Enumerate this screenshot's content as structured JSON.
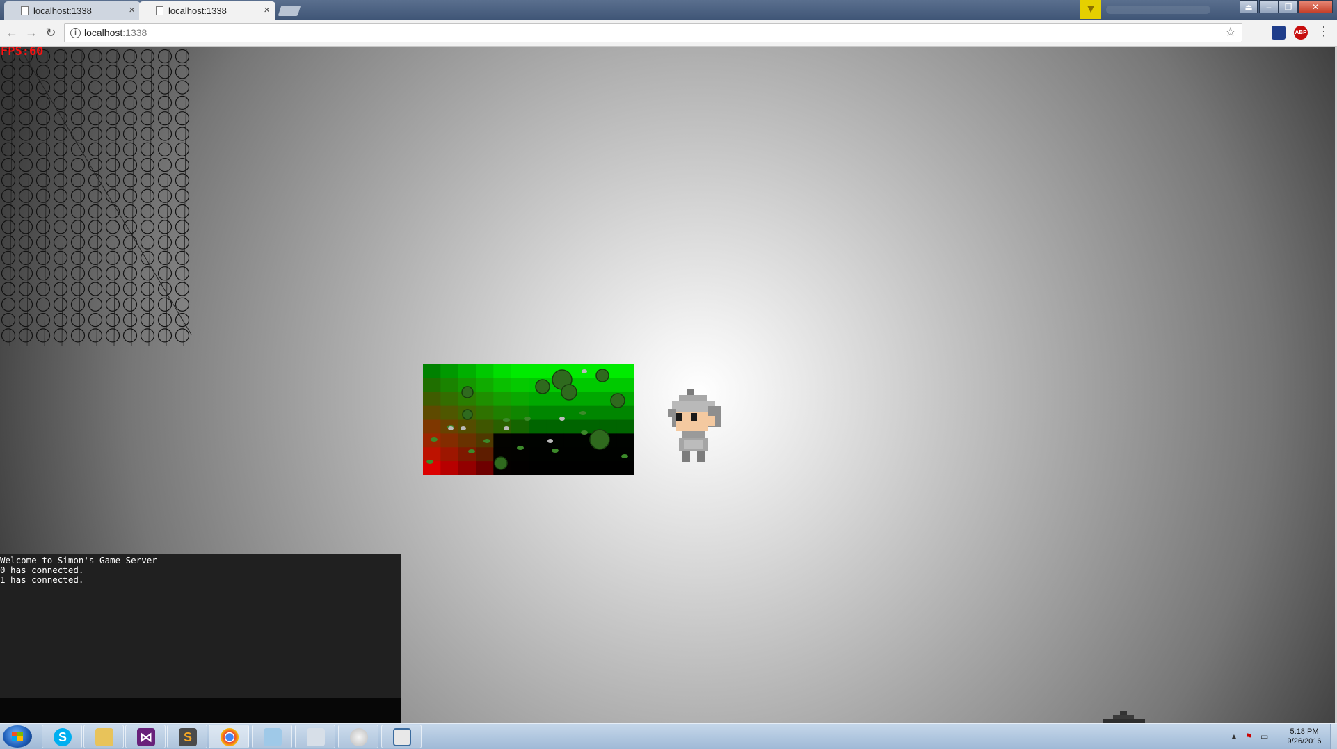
{
  "browser": {
    "tabs": [
      {
        "title": "localhost:1338",
        "active": false
      },
      {
        "title": "localhost:1338",
        "active": true
      }
    ],
    "address": {
      "host": "localhost",
      "port": ":1338"
    },
    "extensions": [
      "bookmark-extension-icon",
      "adblock-plus-icon"
    ],
    "ext_abp_label": "ABP"
  },
  "game": {
    "fps_label": "FPS:60",
    "console": {
      "lines": [
        "Welcome to Simon's Game Server",
        "0 has connected.",
        "1 has connected."
      ]
    },
    "tilemap": {
      "cols": 12,
      "rows": 8
    },
    "grid_overlay": {
      "cols": 11,
      "rows": 19
    }
  },
  "taskbar": {
    "apps": [
      "Skype",
      "Windows Explorer",
      "Visual Studio",
      "Sublime Text",
      "Google Chrome",
      "Sticky Notes",
      "Calculator",
      "Paint",
      "App"
    ],
    "skype_glyph": "S",
    "sublime_glyph": "S",
    "clock": {
      "time": "5:18 PM",
      "date": "9/26/2016"
    }
  }
}
